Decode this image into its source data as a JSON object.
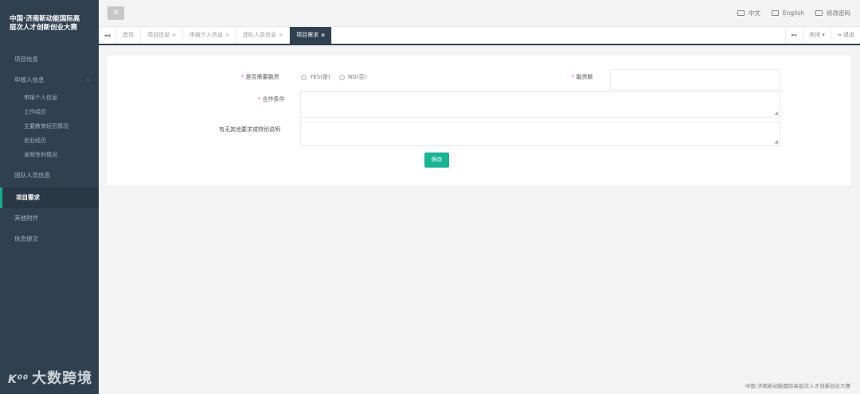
{
  "sidebar": {
    "logo_line1": "中国·济南新动能国际高",
    "logo_line2": "层次人才创新创业大赛",
    "items": [
      {
        "label": "项目信息"
      },
      {
        "label": "申报人信息",
        "caret": "‹"
      },
      {
        "label": "团队人员信息"
      },
      {
        "label": "项目需求"
      },
      {
        "label": "其他附件"
      },
      {
        "label": "信息提交"
      }
    ],
    "subitems": [
      "申报个人信息",
      "工作经历",
      "主要教育经历情况",
      "创业经历",
      "发明专利情况"
    ],
    "watermark_mark": "K⁰⁰",
    "watermark_text": "大数跨境"
  },
  "header": {
    "menu_icon": "≡",
    "links": [
      {
        "label": "中文",
        "icon": "flag-icon"
      },
      {
        "label": "English",
        "icon": "flag-icon"
      },
      {
        "label": "修改密码",
        "icon": "key-icon"
      }
    ]
  },
  "tabs": {
    "left_arrow": "◂◂",
    "items": [
      {
        "label": "首页",
        "close": ""
      },
      {
        "label": "项目信息",
        "close": "⊗"
      },
      {
        "label": "申报个人信息",
        "close": "⊗"
      },
      {
        "label": "团队人员信息",
        "close": "⊗"
      },
      {
        "label": "项目需求",
        "close": "⊗"
      }
    ],
    "right_arrow": "▸▸",
    "close_menu": "关闭 ▾",
    "logout": "⇥ 退出"
  },
  "form": {
    "financing_label": "是否需要融资",
    "yes_label": "YES(是)",
    "no_label": "NO(否)",
    "amount_label": "融资额",
    "amount_value": "",
    "cooperation_label": "合作条件",
    "cooperation_value": "",
    "other_label": "有无其他要求或特别说明",
    "other_value": "",
    "save_label": "保存",
    "required_mark": "*"
  },
  "footer": {
    "text": "中国·济南新动能国际高层次人才创新创业大赛"
  },
  "colors": {
    "sidebar_bg": "#2f4050",
    "accent": "#1ab394",
    "active_tab": "#2f4050"
  }
}
